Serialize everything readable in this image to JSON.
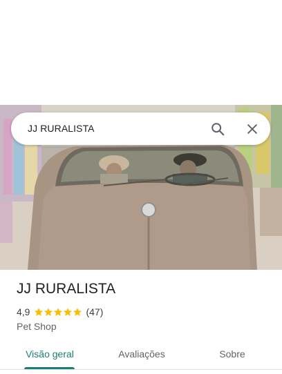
{
  "search": {
    "query": "JJ RURALISTA"
  },
  "place": {
    "name": "JJ RURALISTA",
    "rating": "4,9",
    "stars": 5,
    "review_count": "(47)",
    "category": "Pet Shop"
  },
  "tabs": [
    {
      "label": "Visão geral",
      "active": true
    },
    {
      "label": "Avaliações",
      "active": false
    },
    {
      "label": "Sobre",
      "active": false
    }
  ],
  "colors": {
    "accent": "#1a7f73",
    "star": "#fbbc04"
  },
  "icons": [
    "search-icon",
    "close-icon",
    "star-icon"
  ]
}
